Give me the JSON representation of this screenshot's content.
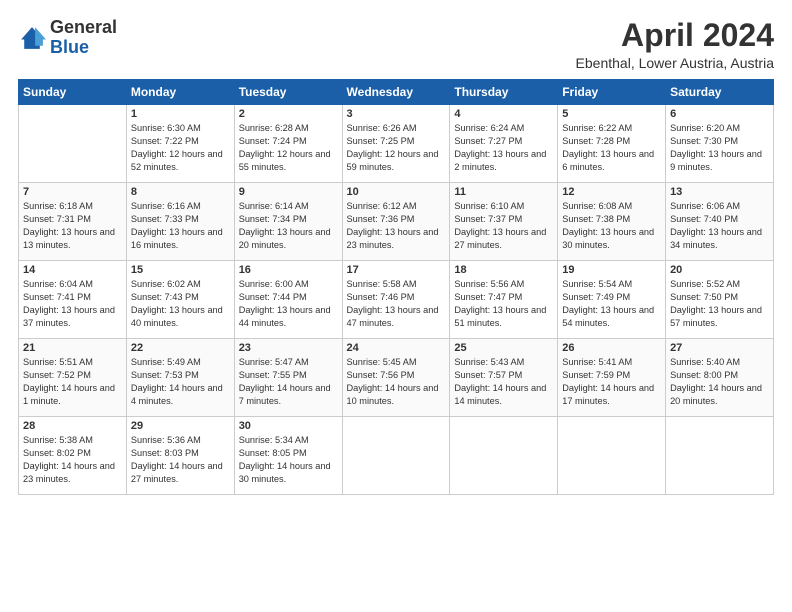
{
  "header": {
    "logo_general": "General",
    "logo_blue": "Blue",
    "title": "April 2024",
    "location": "Ebenthal, Lower Austria, Austria"
  },
  "days_of_week": [
    "Sunday",
    "Monday",
    "Tuesday",
    "Wednesday",
    "Thursday",
    "Friday",
    "Saturday"
  ],
  "weeks": [
    [
      {
        "num": "",
        "sunrise": "",
        "sunset": "",
        "daylight": ""
      },
      {
        "num": "1",
        "sunrise": "Sunrise: 6:30 AM",
        "sunset": "Sunset: 7:22 PM",
        "daylight": "Daylight: 12 hours and 52 minutes."
      },
      {
        "num": "2",
        "sunrise": "Sunrise: 6:28 AM",
        "sunset": "Sunset: 7:24 PM",
        "daylight": "Daylight: 12 hours and 55 minutes."
      },
      {
        "num": "3",
        "sunrise": "Sunrise: 6:26 AM",
        "sunset": "Sunset: 7:25 PM",
        "daylight": "Daylight: 12 hours and 59 minutes."
      },
      {
        "num": "4",
        "sunrise": "Sunrise: 6:24 AM",
        "sunset": "Sunset: 7:27 PM",
        "daylight": "Daylight: 13 hours and 2 minutes."
      },
      {
        "num": "5",
        "sunrise": "Sunrise: 6:22 AM",
        "sunset": "Sunset: 7:28 PM",
        "daylight": "Daylight: 13 hours and 6 minutes."
      },
      {
        "num": "6",
        "sunrise": "Sunrise: 6:20 AM",
        "sunset": "Sunset: 7:30 PM",
        "daylight": "Daylight: 13 hours and 9 minutes."
      }
    ],
    [
      {
        "num": "7",
        "sunrise": "Sunrise: 6:18 AM",
        "sunset": "Sunset: 7:31 PM",
        "daylight": "Daylight: 13 hours and 13 minutes."
      },
      {
        "num": "8",
        "sunrise": "Sunrise: 6:16 AM",
        "sunset": "Sunset: 7:33 PM",
        "daylight": "Daylight: 13 hours and 16 minutes."
      },
      {
        "num": "9",
        "sunrise": "Sunrise: 6:14 AM",
        "sunset": "Sunset: 7:34 PM",
        "daylight": "Daylight: 13 hours and 20 minutes."
      },
      {
        "num": "10",
        "sunrise": "Sunrise: 6:12 AM",
        "sunset": "Sunset: 7:36 PM",
        "daylight": "Daylight: 13 hours and 23 minutes."
      },
      {
        "num": "11",
        "sunrise": "Sunrise: 6:10 AM",
        "sunset": "Sunset: 7:37 PM",
        "daylight": "Daylight: 13 hours and 27 minutes."
      },
      {
        "num": "12",
        "sunrise": "Sunrise: 6:08 AM",
        "sunset": "Sunset: 7:38 PM",
        "daylight": "Daylight: 13 hours and 30 minutes."
      },
      {
        "num": "13",
        "sunrise": "Sunrise: 6:06 AM",
        "sunset": "Sunset: 7:40 PM",
        "daylight": "Daylight: 13 hours and 34 minutes."
      }
    ],
    [
      {
        "num": "14",
        "sunrise": "Sunrise: 6:04 AM",
        "sunset": "Sunset: 7:41 PM",
        "daylight": "Daylight: 13 hours and 37 minutes."
      },
      {
        "num": "15",
        "sunrise": "Sunrise: 6:02 AM",
        "sunset": "Sunset: 7:43 PM",
        "daylight": "Daylight: 13 hours and 40 minutes."
      },
      {
        "num": "16",
        "sunrise": "Sunrise: 6:00 AM",
        "sunset": "Sunset: 7:44 PM",
        "daylight": "Daylight: 13 hours and 44 minutes."
      },
      {
        "num": "17",
        "sunrise": "Sunrise: 5:58 AM",
        "sunset": "Sunset: 7:46 PM",
        "daylight": "Daylight: 13 hours and 47 minutes."
      },
      {
        "num": "18",
        "sunrise": "Sunrise: 5:56 AM",
        "sunset": "Sunset: 7:47 PM",
        "daylight": "Daylight: 13 hours and 51 minutes."
      },
      {
        "num": "19",
        "sunrise": "Sunrise: 5:54 AM",
        "sunset": "Sunset: 7:49 PM",
        "daylight": "Daylight: 13 hours and 54 minutes."
      },
      {
        "num": "20",
        "sunrise": "Sunrise: 5:52 AM",
        "sunset": "Sunset: 7:50 PM",
        "daylight": "Daylight: 13 hours and 57 minutes."
      }
    ],
    [
      {
        "num": "21",
        "sunrise": "Sunrise: 5:51 AM",
        "sunset": "Sunset: 7:52 PM",
        "daylight": "Daylight: 14 hours and 1 minute."
      },
      {
        "num": "22",
        "sunrise": "Sunrise: 5:49 AM",
        "sunset": "Sunset: 7:53 PM",
        "daylight": "Daylight: 14 hours and 4 minutes."
      },
      {
        "num": "23",
        "sunrise": "Sunrise: 5:47 AM",
        "sunset": "Sunset: 7:55 PM",
        "daylight": "Daylight: 14 hours and 7 minutes."
      },
      {
        "num": "24",
        "sunrise": "Sunrise: 5:45 AM",
        "sunset": "Sunset: 7:56 PM",
        "daylight": "Daylight: 14 hours and 10 minutes."
      },
      {
        "num": "25",
        "sunrise": "Sunrise: 5:43 AM",
        "sunset": "Sunset: 7:57 PM",
        "daylight": "Daylight: 14 hours and 14 minutes."
      },
      {
        "num": "26",
        "sunrise": "Sunrise: 5:41 AM",
        "sunset": "Sunset: 7:59 PM",
        "daylight": "Daylight: 14 hours and 17 minutes."
      },
      {
        "num": "27",
        "sunrise": "Sunrise: 5:40 AM",
        "sunset": "Sunset: 8:00 PM",
        "daylight": "Daylight: 14 hours and 20 minutes."
      }
    ],
    [
      {
        "num": "28",
        "sunrise": "Sunrise: 5:38 AM",
        "sunset": "Sunset: 8:02 PM",
        "daylight": "Daylight: 14 hours and 23 minutes."
      },
      {
        "num": "29",
        "sunrise": "Sunrise: 5:36 AM",
        "sunset": "Sunset: 8:03 PM",
        "daylight": "Daylight: 14 hours and 27 minutes."
      },
      {
        "num": "30",
        "sunrise": "Sunrise: 5:34 AM",
        "sunset": "Sunset: 8:05 PM",
        "daylight": "Daylight: 14 hours and 30 minutes."
      },
      {
        "num": "",
        "sunrise": "",
        "sunset": "",
        "daylight": ""
      },
      {
        "num": "",
        "sunrise": "",
        "sunset": "",
        "daylight": ""
      },
      {
        "num": "",
        "sunrise": "",
        "sunset": "",
        "daylight": ""
      },
      {
        "num": "",
        "sunrise": "",
        "sunset": "",
        "daylight": ""
      }
    ]
  ]
}
